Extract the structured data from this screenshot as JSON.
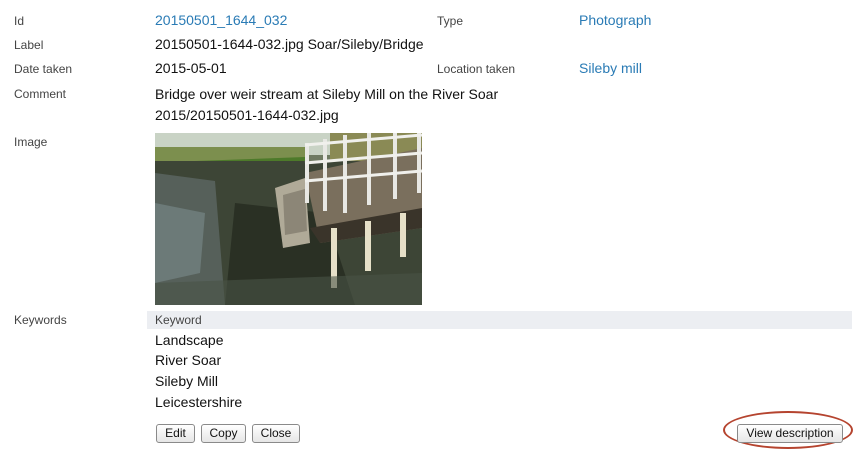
{
  "fields": {
    "id_label": "Id",
    "id_value": "20150501_1644_032",
    "type_label": "Type",
    "type_value": "Photograph",
    "label_label": "Label",
    "label_value": "20150501-1644-032.jpg Soar/Sileby/Bridge",
    "date_label": "Date taken",
    "date_value": "2015-05-01",
    "location_label": "Location taken",
    "location_value": "Sileby mill",
    "comment_label": "Comment",
    "comment_line1": "Bridge over weir stream at Sileby Mill on the River Soar",
    "comment_line2": "2015/20150501-1644-032.jpg",
    "image_label": "Image"
  },
  "keywords": {
    "label": "Keywords",
    "column_header": "Keyword",
    "items": [
      "Landscape",
      "River Soar",
      "Sileby Mill",
      "Leicestershire"
    ]
  },
  "buttons": {
    "edit": "Edit",
    "copy": "Copy",
    "close": "Close",
    "view_description": "View description"
  },
  "colors": {
    "link": "#2a7bb5",
    "highlight_ring": "#b5442f",
    "keyword_header_bg": "#eceef2"
  }
}
